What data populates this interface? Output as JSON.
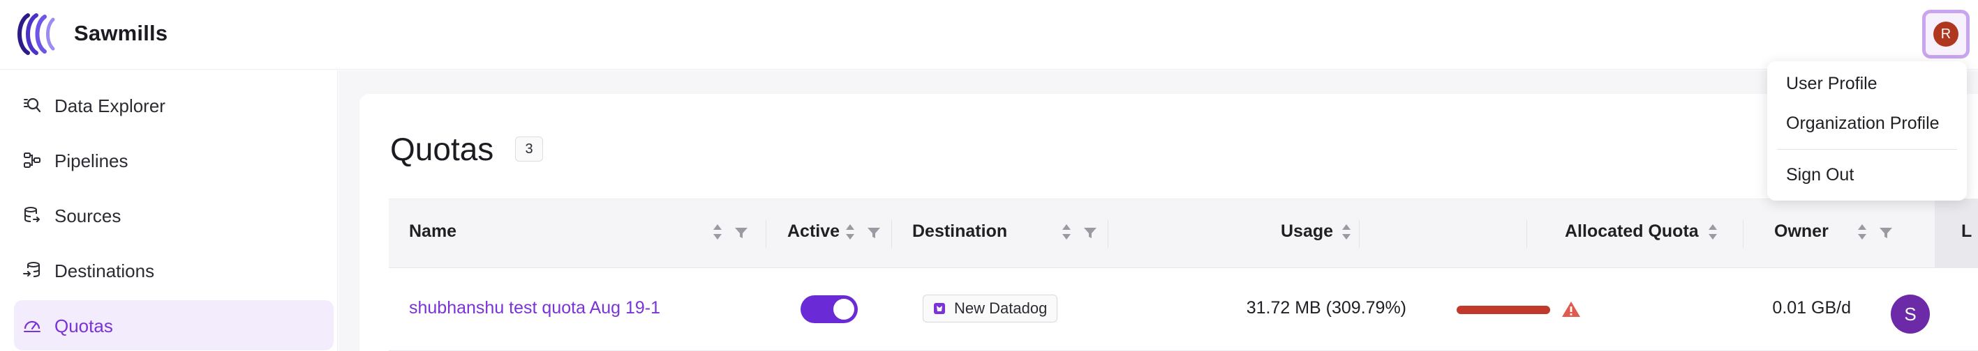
{
  "app": {
    "name": "Sawmills"
  },
  "user": {
    "avatar_initial": "R",
    "avatar_color": "#b0371f"
  },
  "sidebar": {
    "items": [
      {
        "label": "Data Explorer",
        "icon": "data-explorer-icon"
      },
      {
        "label": "Pipelines",
        "icon": "pipelines-icon"
      },
      {
        "label": "Sources",
        "icon": "sources-icon"
      },
      {
        "label": "Destinations",
        "icon": "destinations-icon"
      },
      {
        "label": "Quotas",
        "icon": "quotas-icon",
        "active": true
      }
    ]
  },
  "page": {
    "title": "Quotas",
    "count": "3"
  },
  "table": {
    "columns": [
      "Name",
      "Active",
      "Destination",
      "Usage",
      "Allocated Quota",
      "Owner",
      "L"
    ],
    "rows": [
      {
        "name": "shubhanshu test quota Aug 19-1",
        "active": true,
        "destination": "New Datadog",
        "usage": "31.72 MB (309.79%)",
        "usage_fraction": 1.0,
        "usage_bar_color": "#c0392b",
        "warning": true,
        "allocated_quota": "0.01 GB/d",
        "owner_initial": "S",
        "owner_color": "#6c2aa8"
      }
    ]
  },
  "user_menu": {
    "items": [
      "User Profile",
      "Organization Profile",
      "Sign Out"
    ]
  },
  "colors": {
    "accent": "#7a33d6",
    "toggle_on": "#6a2bd6",
    "avatar_ring": "#c9a4ef"
  }
}
